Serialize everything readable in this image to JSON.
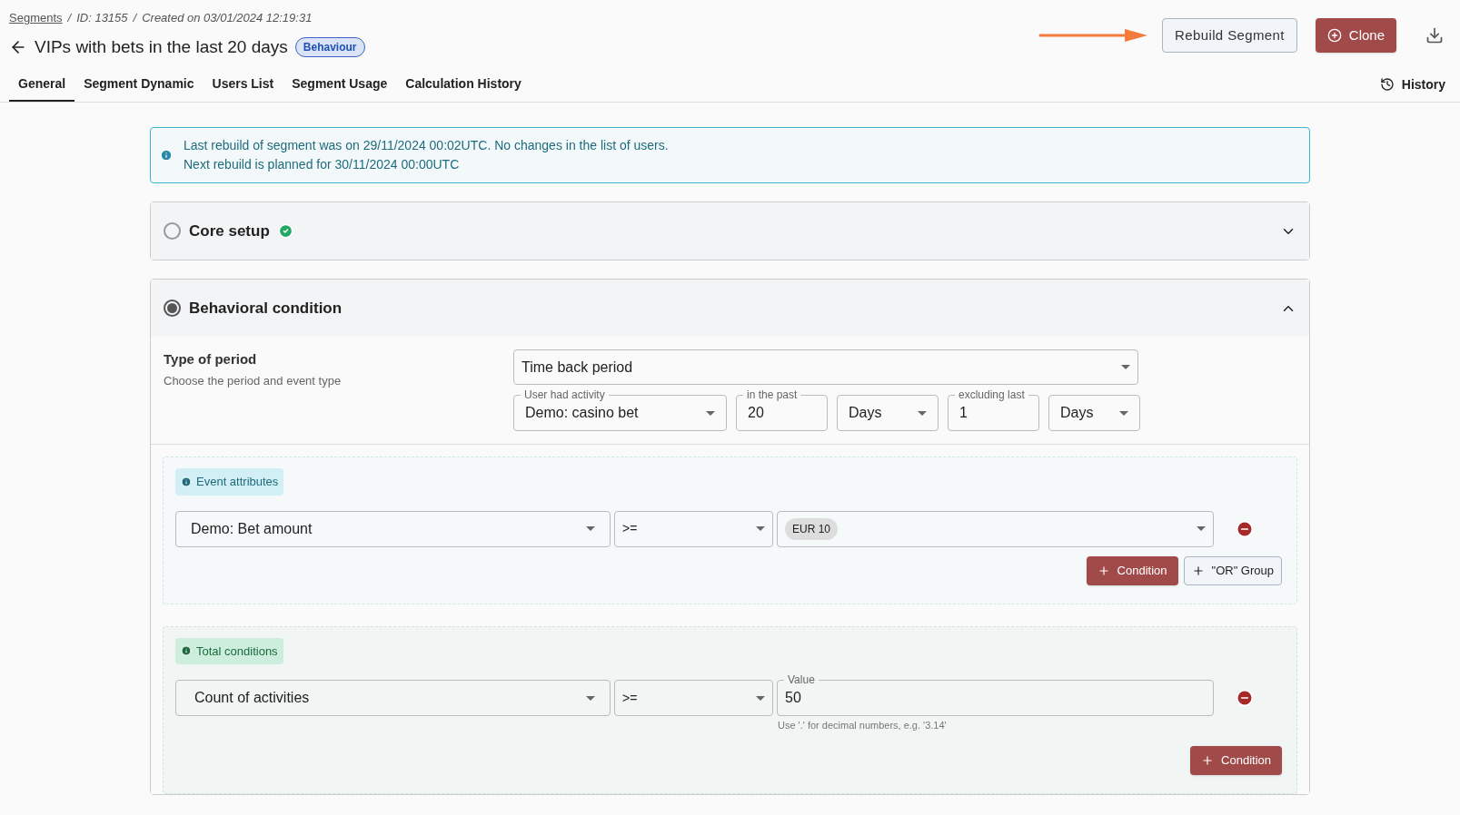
{
  "breadcrumb": {
    "link": "Segments",
    "separator": "/",
    "id": "ID: 13155",
    "created": "Created on 03/01/2024 12:19:31"
  },
  "title": "VIPs with bets in the last 20 days",
  "badge": "Behaviour",
  "actions": {
    "rebuild": "Rebuild Segment",
    "clone": "Clone"
  },
  "tabs": [
    {
      "label": "General",
      "selected": true
    },
    {
      "label": "Segment Dynamic",
      "selected": false
    },
    {
      "label": "Users List",
      "selected": false
    },
    {
      "label": "Segment Usage",
      "selected": false
    },
    {
      "label": "Calculation History",
      "selected": false
    }
  ],
  "history": "History",
  "info": [
    "Last rebuild of segment was on 29/11/2024 00:02UTC. No changes in the list of users.",
    "Next rebuild is planned for 30/11/2024 00:00UTC"
  ],
  "sections": [
    {
      "title": "Core setup",
      "selected": false,
      "expanded": false,
      "complete": true
    },
    {
      "title": "Behavioral condition",
      "selected": true,
      "expanded": true,
      "complete": false
    }
  ],
  "period": {
    "label": "Type of period",
    "hint": "Choose the period and event type",
    "type": "Time back period",
    "fields": [
      {
        "kind": "select",
        "label": "User had activity",
        "value": "Demo: casino bet"
      },
      {
        "kind": "input",
        "label": "in the past",
        "value": "20"
      },
      {
        "kind": "select",
        "value": "Days"
      },
      {
        "kind": "input",
        "label": "excluding last",
        "value": "1"
      },
      {
        "kind": "select",
        "value": "Days"
      }
    ]
  },
  "event_attributes": {
    "tag": "Event attributes",
    "attribute": "Demo: Bet amount",
    "operator": ">=",
    "value_chip": "EUR 10",
    "buttons": [
      "Condition",
      "\"OR\" Group"
    ]
  },
  "total_conditions": {
    "tag": "Total conditions",
    "attribute": "Count of activities",
    "operator": ">=",
    "value_label": "Value",
    "value": "50",
    "helper": "Use '.' for decimal numbers, e.g. '3.14'",
    "buttons": [
      "Condition"
    ]
  }
}
